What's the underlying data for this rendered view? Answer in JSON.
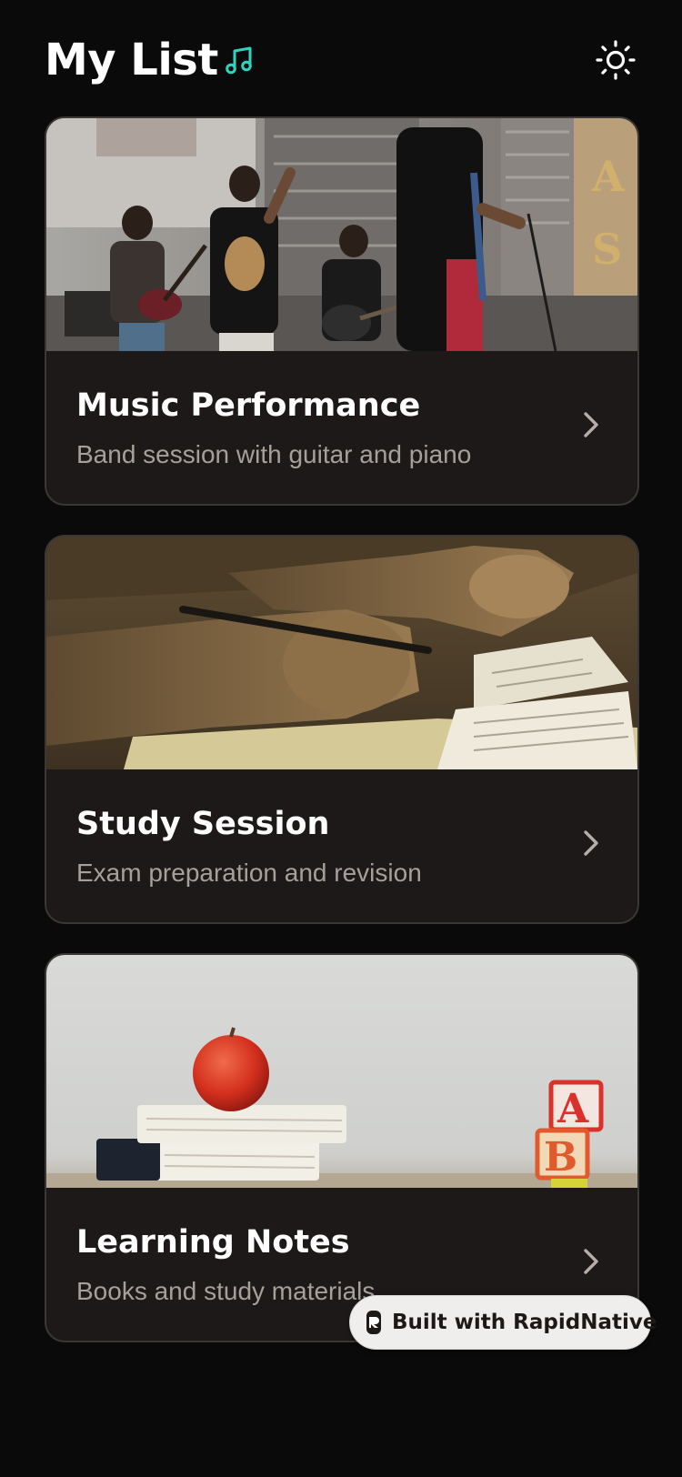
{
  "header": {
    "title": "My List",
    "music_icon": "music-note-icon",
    "theme_icon": "sun-icon"
  },
  "colors": {
    "background": "#0b0a0a",
    "card_background": "#1c1918",
    "card_border": "#3b3735",
    "accent": "#2dd4bf",
    "subtitle": "#a6a09b",
    "badge_background": "#efeeed"
  },
  "cards": [
    {
      "title": "Music Performance",
      "subtitle": "Band session with guitar and piano",
      "image_icon": "band-concert-photo",
      "chevron_icon": "chevron-right-icon"
    },
    {
      "title": "Study Session",
      "subtitle": "Exam preparation and revision",
      "image_icon": "hands-writing-book-photo",
      "chevron_icon": "chevron-right-icon"
    },
    {
      "title": "Learning Notes",
      "subtitle": "Books and study materials",
      "image_icon": "apple-books-blocks-photo",
      "chevron_icon": "chevron-right-icon"
    }
  ],
  "badge": {
    "label": "Built with RapidNative",
    "logo_icon": "rapidnative-logo-icon"
  }
}
